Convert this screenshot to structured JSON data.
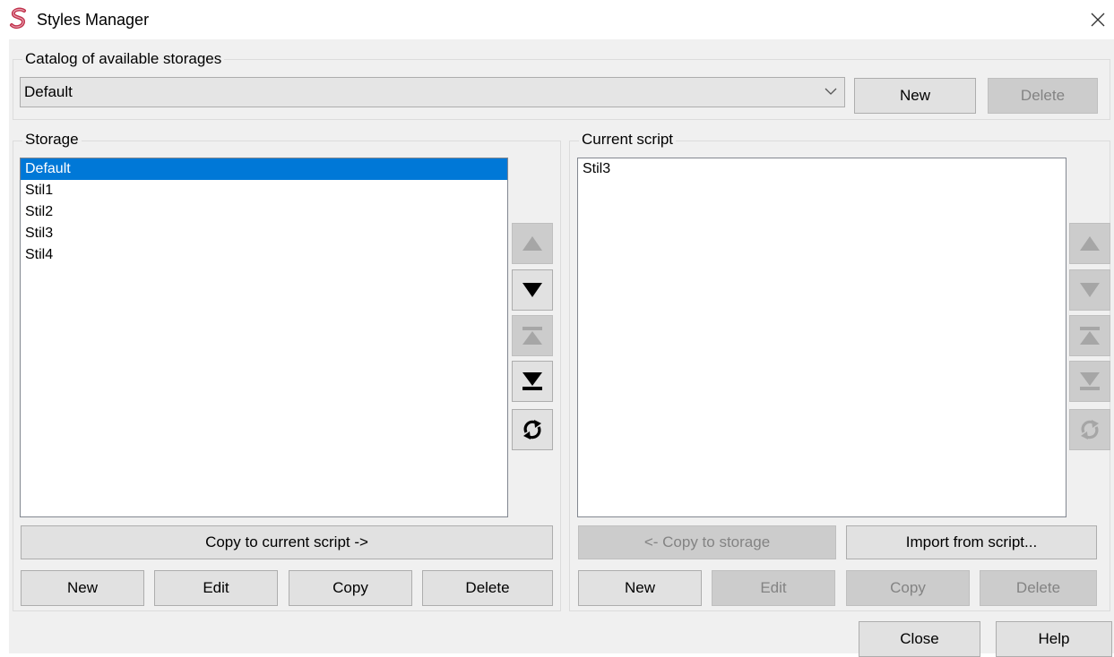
{
  "window": {
    "title": "Styles Manager",
    "app_icon": "styles-s-icon",
    "close_icon": "close-icon"
  },
  "catalog": {
    "label": "Catalog of available storages",
    "selected_value": "Default",
    "new_label": "New",
    "delete_label": "Delete"
  },
  "storage": {
    "label": "Storage",
    "items": [
      "Default",
      "Stil1",
      "Stil2",
      "Stil3",
      "Stil4"
    ],
    "selected_index": 0,
    "copy_to_current_label": "Copy to current script ->",
    "new_label": "New",
    "edit_label": "Edit",
    "copy_label": "Copy",
    "delete_label": "Delete"
  },
  "current_script": {
    "label": "Current script",
    "items": [
      "Stil3"
    ],
    "copy_to_storage_label": "<- Copy to storage",
    "import_label": "Import from script...",
    "new_label": "New",
    "edit_label": "Edit",
    "copy_label": "Copy",
    "delete_label": "Delete"
  },
  "footer": {
    "close_label": "Close",
    "help_label": "Help"
  },
  "colors": {
    "selection": "#0078d7",
    "dialog_background": "#f0f0f0",
    "icon_accent": "#c0304a"
  }
}
